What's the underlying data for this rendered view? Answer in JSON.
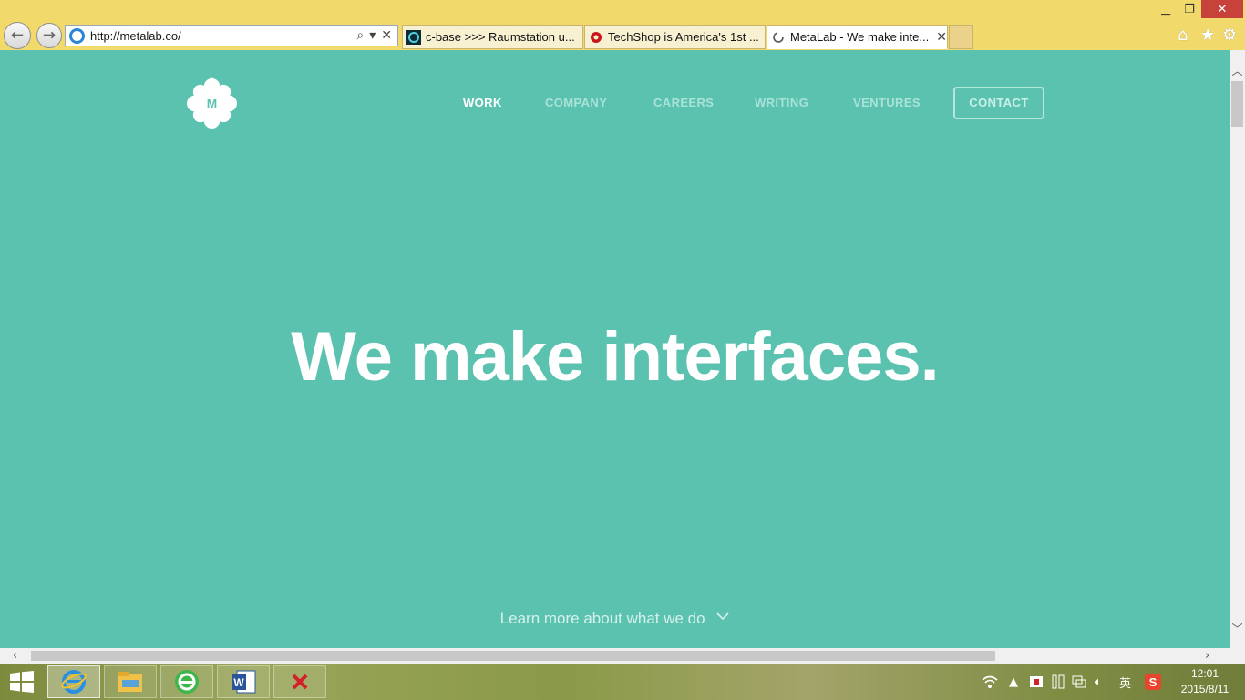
{
  "browser": {
    "address_url": "http://metalab.co/",
    "tabs": [
      {
        "title": "c-base >>> Raumstation u...",
        "favicon": "cbase-icon"
      },
      {
        "title": "TechShop is America's 1st ...",
        "favicon": "gear-icon"
      },
      {
        "title": "MetaLab - We make inte...",
        "favicon": "loading-icon"
      }
    ],
    "window_controls": [
      "minimize",
      "restore",
      "close"
    ],
    "toolbar_icons": [
      "home-icon",
      "favorites-star-icon",
      "settings-gear-icon"
    ]
  },
  "site": {
    "logo_letter": "M",
    "nav": [
      {
        "label": "WORK",
        "active": true
      },
      {
        "label": "COMPANY",
        "active": false
      },
      {
        "label": "CAREERS",
        "active": false
      },
      {
        "label": "WRITING",
        "active": false
      },
      {
        "label": "VENTURES",
        "active": false
      },
      {
        "label": "CONTACT",
        "active": false
      }
    ],
    "hero_title": "We make interfaces.",
    "learn_more": "Learn more about what we do"
  },
  "colors": {
    "page_bg": "#5cc2b0",
    "chrome_bg": "#f2d96b",
    "close_red": "#c7423a"
  },
  "taskbar": {
    "apps": [
      "internet-explorer-icon",
      "file-explorer-icon",
      "green-app-icon",
      "word-icon",
      "red-x-app-icon"
    ],
    "tray_ime": "英",
    "time": "12:01",
    "date": "2015/8/11"
  }
}
